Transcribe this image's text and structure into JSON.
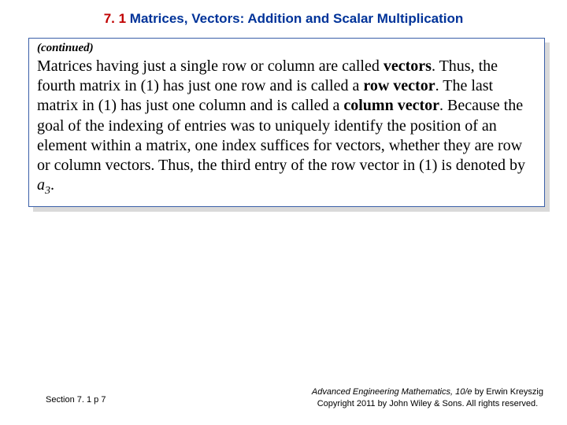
{
  "header": {
    "num": "7. 1",
    "rest": " Matrices, Vectors:  Addition and Scalar Multiplication"
  },
  "continued_label": "(continued)",
  "body": {
    "s1": "Matrices having just a single row or column are called ",
    "b1": "vectors",
    "s2": ". Thus, the fourth matrix in (1) has just one row and is called a ",
    "b2": "row vector",
    "s3": ". The last matrix in (1) has just one column and is called a ",
    "b3": "column vector",
    "s4": ". Because the goal of the indexing of entries was to uniquely identify the position of an element within a matrix, one index suffices for vectors, whether they are row or column vectors. Thus, the third entry of the row vector in (1) is denoted by ",
    "a": "a",
    "sub": "3",
    "s5": "."
  },
  "footer": {
    "left": "Section 7. 1  p 7",
    "right_title": "Advanced Engineering Mathematics, 10/e",
    "right_author": " by Erwin Kreyszig",
    "right_copy": "Copyright 2011 by John Wiley & Sons. All rights reserved."
  }
}
